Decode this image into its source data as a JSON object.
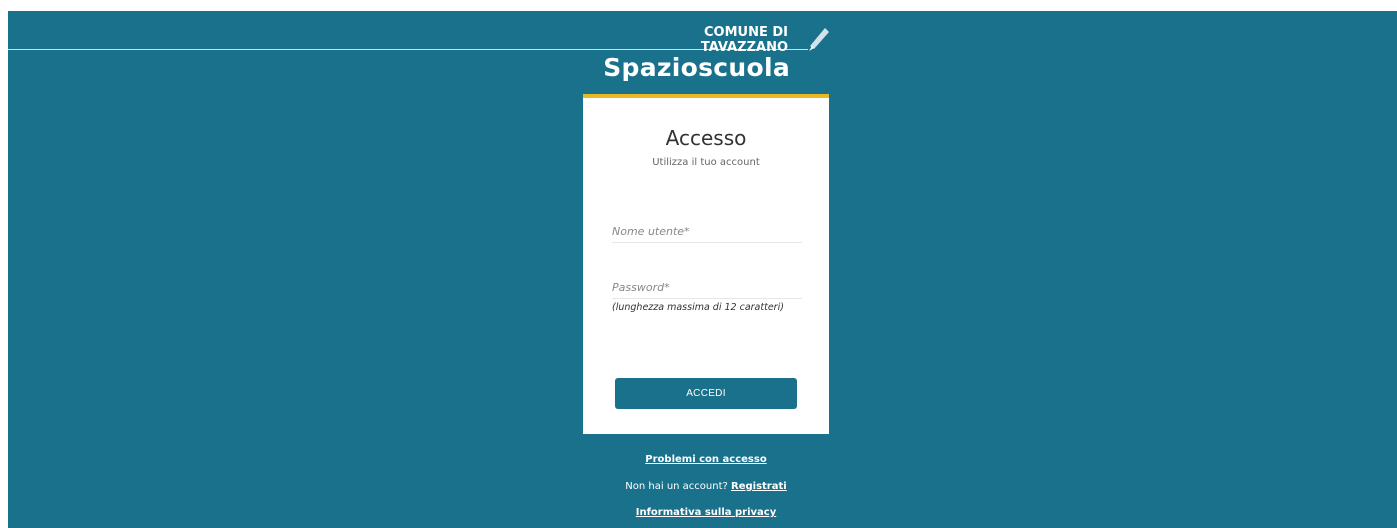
{
  "header": {
    "municipality": "COMUNE DI TAVAZZANO",
    "app_title": "Spazioscuola",
    "edit_icon": "pencil-icon"
  },
  "login": {
    "title": "Accesso",
    "subtitle": "Utilizza il tuo account",
    "username_placeholder": "Nome utente*",
    "password_placeholder": "Password*",
    "password_hint": "(lunghezza massima di 12 caratteri)",
    "submit_label": "ACCEDI"
  },
  "footer": {
    "problems_link": "Problemi con accesso",
    "no_account_text": "Non hai un account? ",
    "register_link": "Registrati",
    "privacy_link": "Informativa sulla privacy"
  },
  "colors": {
    "background": "#19718b",
    "accent": "#e8b923",
    "card": "#ffffff"
  }
}
